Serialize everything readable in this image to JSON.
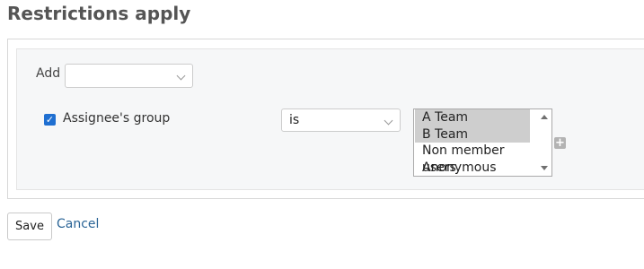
{
  "page": {
    "title": "Restrictions apply"
  },
  "add": {
    "label": "Add",
    "selected": ""
  },
  "condition": {
    "field_label": "Assignee's group",
    "checked": true,
    "operator": "is",
    "options": [
      {
        "label": "A Team",
        "selected": true
      },
      {
        "label": "B Team",
        "selected": true
      },
      {
        "label": "Non member users",
        "selected": false
      },
      {
        "label": "Anonymous users",
        "selected": false
      }
    ]
  },
  "actions": {
    "save_label": "Save",
    "cancel_label": "Cancel"
  },
  "colors": {
    "link": "#2a6496",
    "checkbox": "#1f6fd1",
    "selection": "#cecece"
  },
  "icons": {
    "checkbox": "checkmark-icon",
    "add_value": "plus-icon",
    "dropdown": "chevron-down-icon"
  }
}
